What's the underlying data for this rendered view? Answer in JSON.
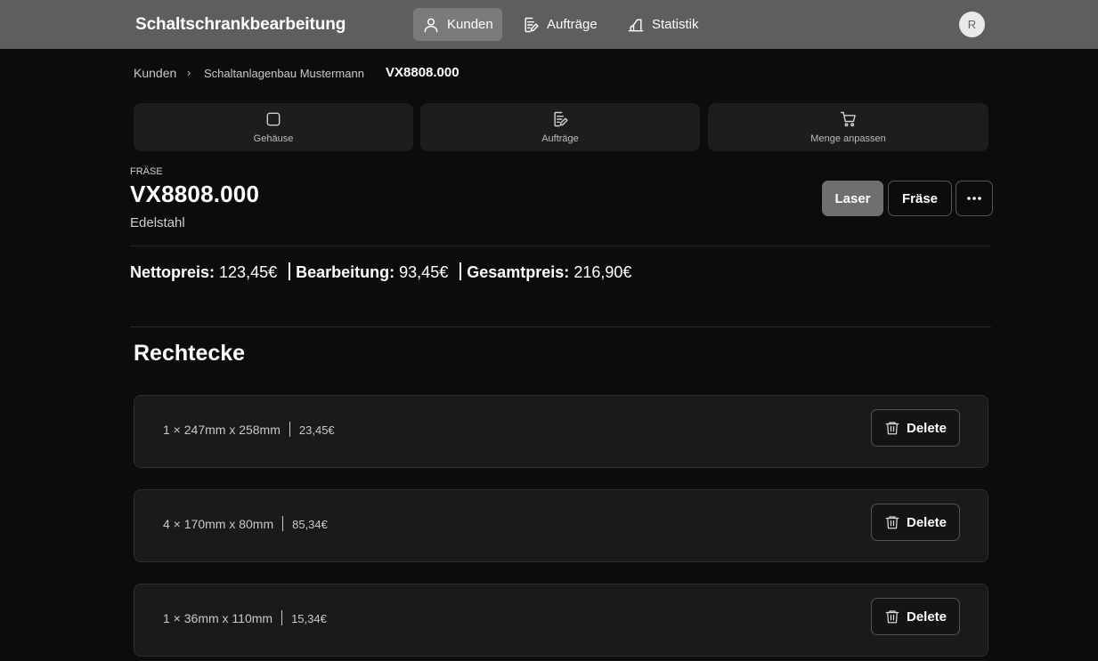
{
  "app": {
    "title": "Schaltschrankbearbeitung",
    "avatar_initial": "R"
  },
  "nav": [
    {
      "label": "Kunden",
      "icon": "user-icon",
      "active": true
    },
    {
      "label": "Aufträge",
      "icon": "document-edit-icon",
      "active": false
    },
    {
      "label": "Statistik",
      "icon": "chart-icon",
      "active": false
    }
  ],
  "breadcrumb": [
    "Kunden",
    "Schaltanlagenbau Mustermann",
    "VX8808.000"
  ],
  "card_tabs": [
    {
      "label": "Gehäuse",
      "icon": "square-icon"
    },
    {
      "label": "Aufträge",
      "icon": "document-edit-icon"
    },
    {
      "label": "Menge anpassen",
      "icon": "cart-icon"
    }
  ],
  "part": {
    "kicker": "FRÄSE",
    "title": "VX8808.000",
    "material": "Edelstahl"
  },
  "actions": {
    "laser": "Laser",
    "fraese": "Fräse",
    "more": "···"
  },
  "prices": {
    "net_label": "Nettopreis:",
    "net_value": "123,45€",
    "processing_label": "Bearbeitung:",
    "processing_value": "93,45€",
    "total_label": "Gesamtpreis:",
    "total_value": "216,90€"
  },
  "section": {
    "title": "Rechtecke"
  },
  "rectangles": [
    {
      "desc": "1 × 247mm x 258mm",
      "price": "23,45€",
      "delete_label": "Delete"
    },
    {
      "desc": "4 × 170mm x 80mm",
      "price": "85,34€",
      "delete_label": "Delete"
    },
    {
      "desc": "1 × 36mm x 110mm",
      "price": "15,34€",
      "delete_label": "Delete"
    }
  ],
  "colors": {
    "topbar": "#5e5e5e",
    "background": "#0c0c0c",
    "card": "#1d1d1d",
    "primary_button": "#6f6f6f"
  }
}
